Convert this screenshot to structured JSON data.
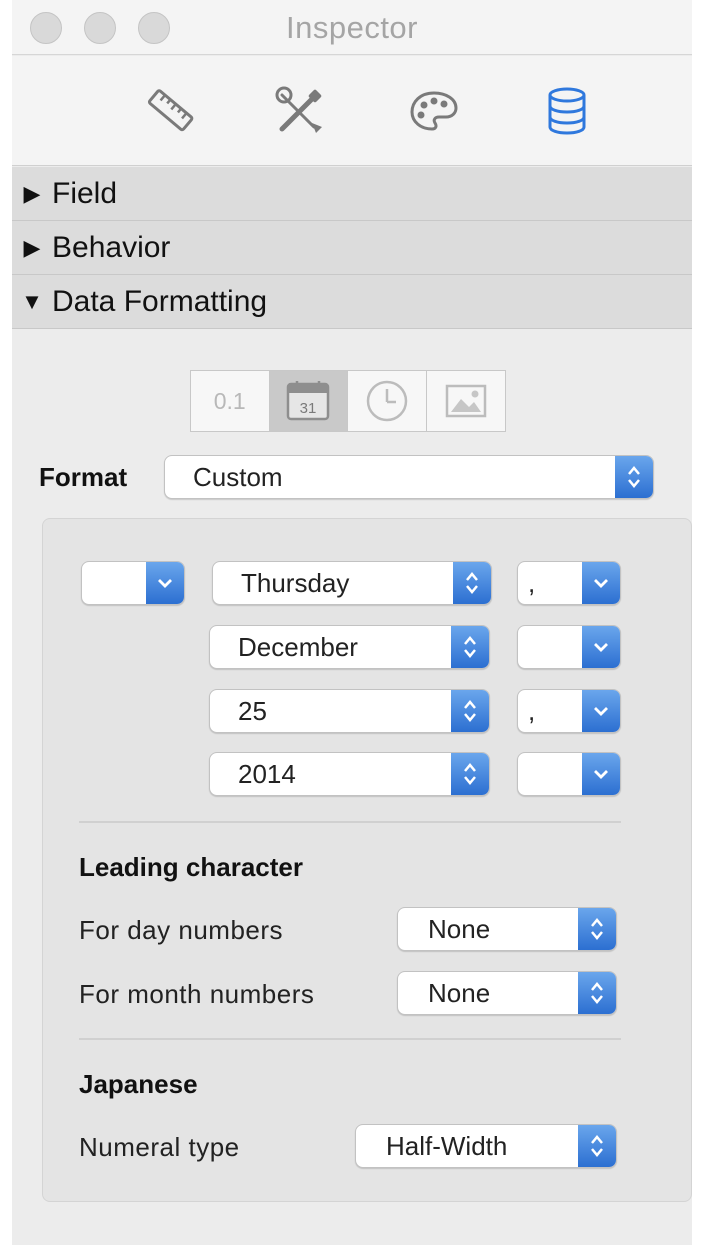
{
  "window": {
    "title": "Inspector"
  },
  "toolbar": {
    "tabs": [
      {
        "icon": "ruler-icon"
      },
      {
        "icon": "tools-icon"
      },
      {
        "icon": "palette-icon"
      },
      {
        "icon": "database-icon",
        "selected": true
      }
    ]
  },
  "sections": [
    {
      "label": "Field",
      "expanded": false
    },
    {
      "label": "Behavior",
      "expanded": false
    },
    {
      "label": "Data Formatting",
      "expanded": true
    }
  ],
  "format_type": {
    "segments": [
      {
        "label": "0.1",
        "icon": "number-icon"
      },
      {
        "icon": "calendar-icon",
        "calendar_day": "31",
        "selected": true
      },
      {
        "icon": "clock-icon"
      },
      {
        "icon": "image-icon"
      }
    ]
  },
  "format": {
    "label": "Format",
    "value": "Custom"
  },
  "date_parts": [
    {
      "prefix": "",
      "value": "Thursday",
      "separator": ","
    },
    {
      "value": "December",
      "separator": ""
    },
    {
      "value": "25",
      "separator": ","
    },
    {
      "value": "2014",
      "separator": ""
    }
  ],
  "leading_character": {
    "heading": "Leading character",
    "rows": [
      {
        "label": "For day numbers",
        "value": "None"
      },
      {
        "label": "For month numbers",
        "value": "None"
      }
    ]
  },
  "japanese": {
    "heading": "Japanese",
    "numeral_type": {
      "label": "Numeral type",
      "value": "Half-Width"
    }
  },
  "colors": {
    "accent": "#2c6fd1",
    "section_bg": "#dcdcdc",
    "window_bg": "#ececec"
  }
}
